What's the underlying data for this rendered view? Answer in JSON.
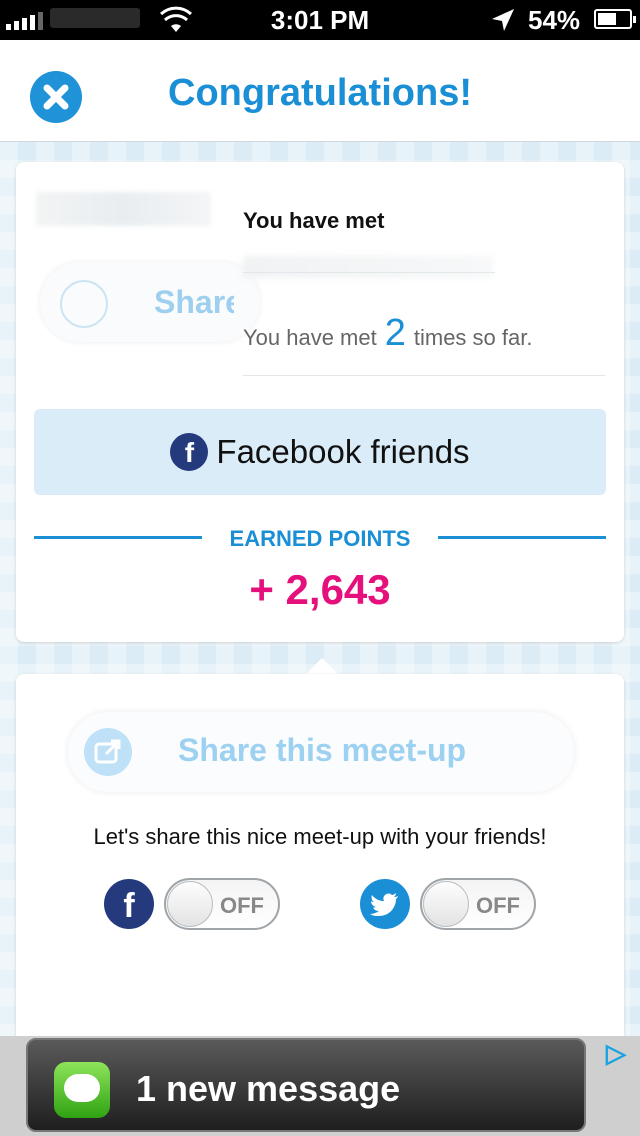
{
  "status_bar": {
    "time": "3:01 PM",
    "battery_pct": "54%"
  },
  "header": {
    "title": "Congratulations!"
  },
  "meet_card": {
    "met_title": "You have met",
    "ghost_share_label": "Share",
    "met_prefix": "You have met",
    "met_count": "2",
    "met_suffix": "times so far.",
    "fb_button_label": "Facebook friends",
    "earned_label": "EARNED POINTS",
    "earned_value": "+ 2,643"
  },
  "share_card": {
    "button_label": "Share this meet-up",
    "message": "Let's share this nice meet-up with your friends!",
    "facebook_toggle": "OFF",
    "twitter_toggle": "OFF"
  },
  "ad": {
    "text": "1 new message"
  },
  "colors": {
    "accent": "#1a8fd6",
    "points": "#e5107b",
    "facebook": "#243a7c"
  }
}
